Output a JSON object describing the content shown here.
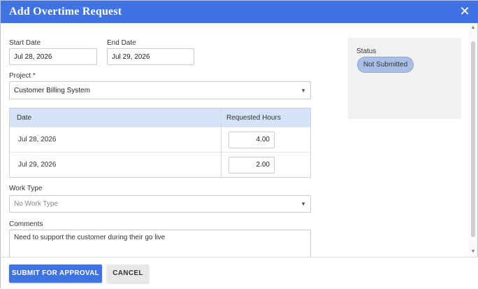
{
  "dialog": {
    "title": "Add Overtime Request",
    "close_icon": "close-icon",
    "close_glyph": "✕"
  },
  "form": {
    "start_date_label": "Start Date",
    "start_date_value": "Jul 28, 2026",
    "end_date_label": "End Date",
    "end_date_value": "Jul 29, 2026",
    "project_label": "Project *",
    "project_value": "Customer Billing System",
    "table": {
      "headers": [
        "Date",
        "Requested Hours"
      ],
      "rows": [
        {
          "date": "Jul 28, 2026",
          "hours": "4.00"
        },
        {
          "date": "Jul 29, 2026",
          "hours": "2.00"
        }
      ]
    },
    "work_type_label": "Work Type",
    "work_type_placeholder": "No Work Type",
    "comments_label": "Comments",
    "comments_value": "Need to support the customer during their go live"
  },
  "status": {
    "label": "Status",
    "value": "Not Submitted"
  },
  "footer": {
    "submit_label": "SUBMIT FOR APPROVAL",
    "cancel_label": "CANCEL"
  },
  "icons": {
    "dropdown": "chevron-down-icon",
    "dropdown_glyph": "▼",
    "scroll_up_glyph": "▲",
    "scroll_down_glyph": "▼"
  },
  "colors": {
    "primary": "#3f72e2",
    "table_header": "#d6e2f7",
    "status_badge": "#a9bfe6",
    "status_panel": "#f1f1f1"
  }
}
